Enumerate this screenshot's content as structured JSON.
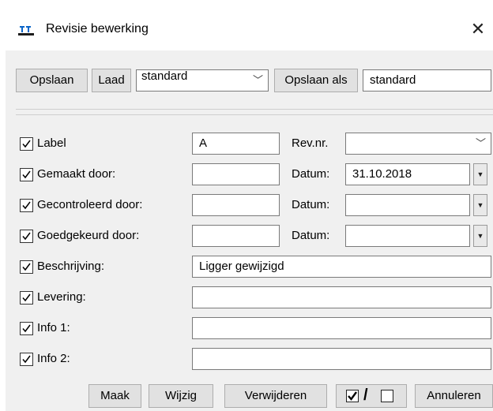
{
  "window": {
    "title": "Revisie bewerking",
    "close_icon": "close-icon",
    "app_icon": "revision-app-icon"
  },
  "template_bar": {
    "save_label": "Opslaan",
    "load_label": "Laad",
    "template_value": "standard",
    "save_as_label": "Opslaan als",
    "save_as_value": "standard"
  },
  "fields": {
    "label": {
      "checked": true,
      "label": "Label",
      "value": "A"
    },
    "rev_nr": {
      "label": "Rev.nr.",
      "value": ""
    },
    "made_by": {
      "checked": true,
      "label": "Gemaakt door:",
      "value": "",
      "date_label": "Datum:",
      "date_value": "31.10.2018"
    },
    "checked_by": {
      "checked": true,
      "label": "Gecontroleerd door:",
      "value": "",
      "date_label": "Datum:",
      "date_value": ""
    },
    "approved_by": {
      "checked": true,
      "label": "Goedgekeurd door:",
      "value": "",
      "date_label": "Datum:",
      "date_value": ""
    },
    "description": {
      "checked": true,
      "label": "Beschrijving:",
      "value": "Ligger gewijzigd"
    },
    "delivery": {
      "checked": true,
      "label": "Levering:",
      "value": ""
    },
    "info1": {
      "checked": true,
      "label": "Info 1:",
      "value": ""
    },
    "info2": {
      "checked": true,
      "label": "Info 2:",
      "value": ""
    }
  },
  "footer": {
    "create_label": "Maak",
    "modify_label": "Wijzig",
    "delete_label": "Verwijderen",
    "toggle_separator": "/",
    "cancel_label": "Annuleren"
  }
}
